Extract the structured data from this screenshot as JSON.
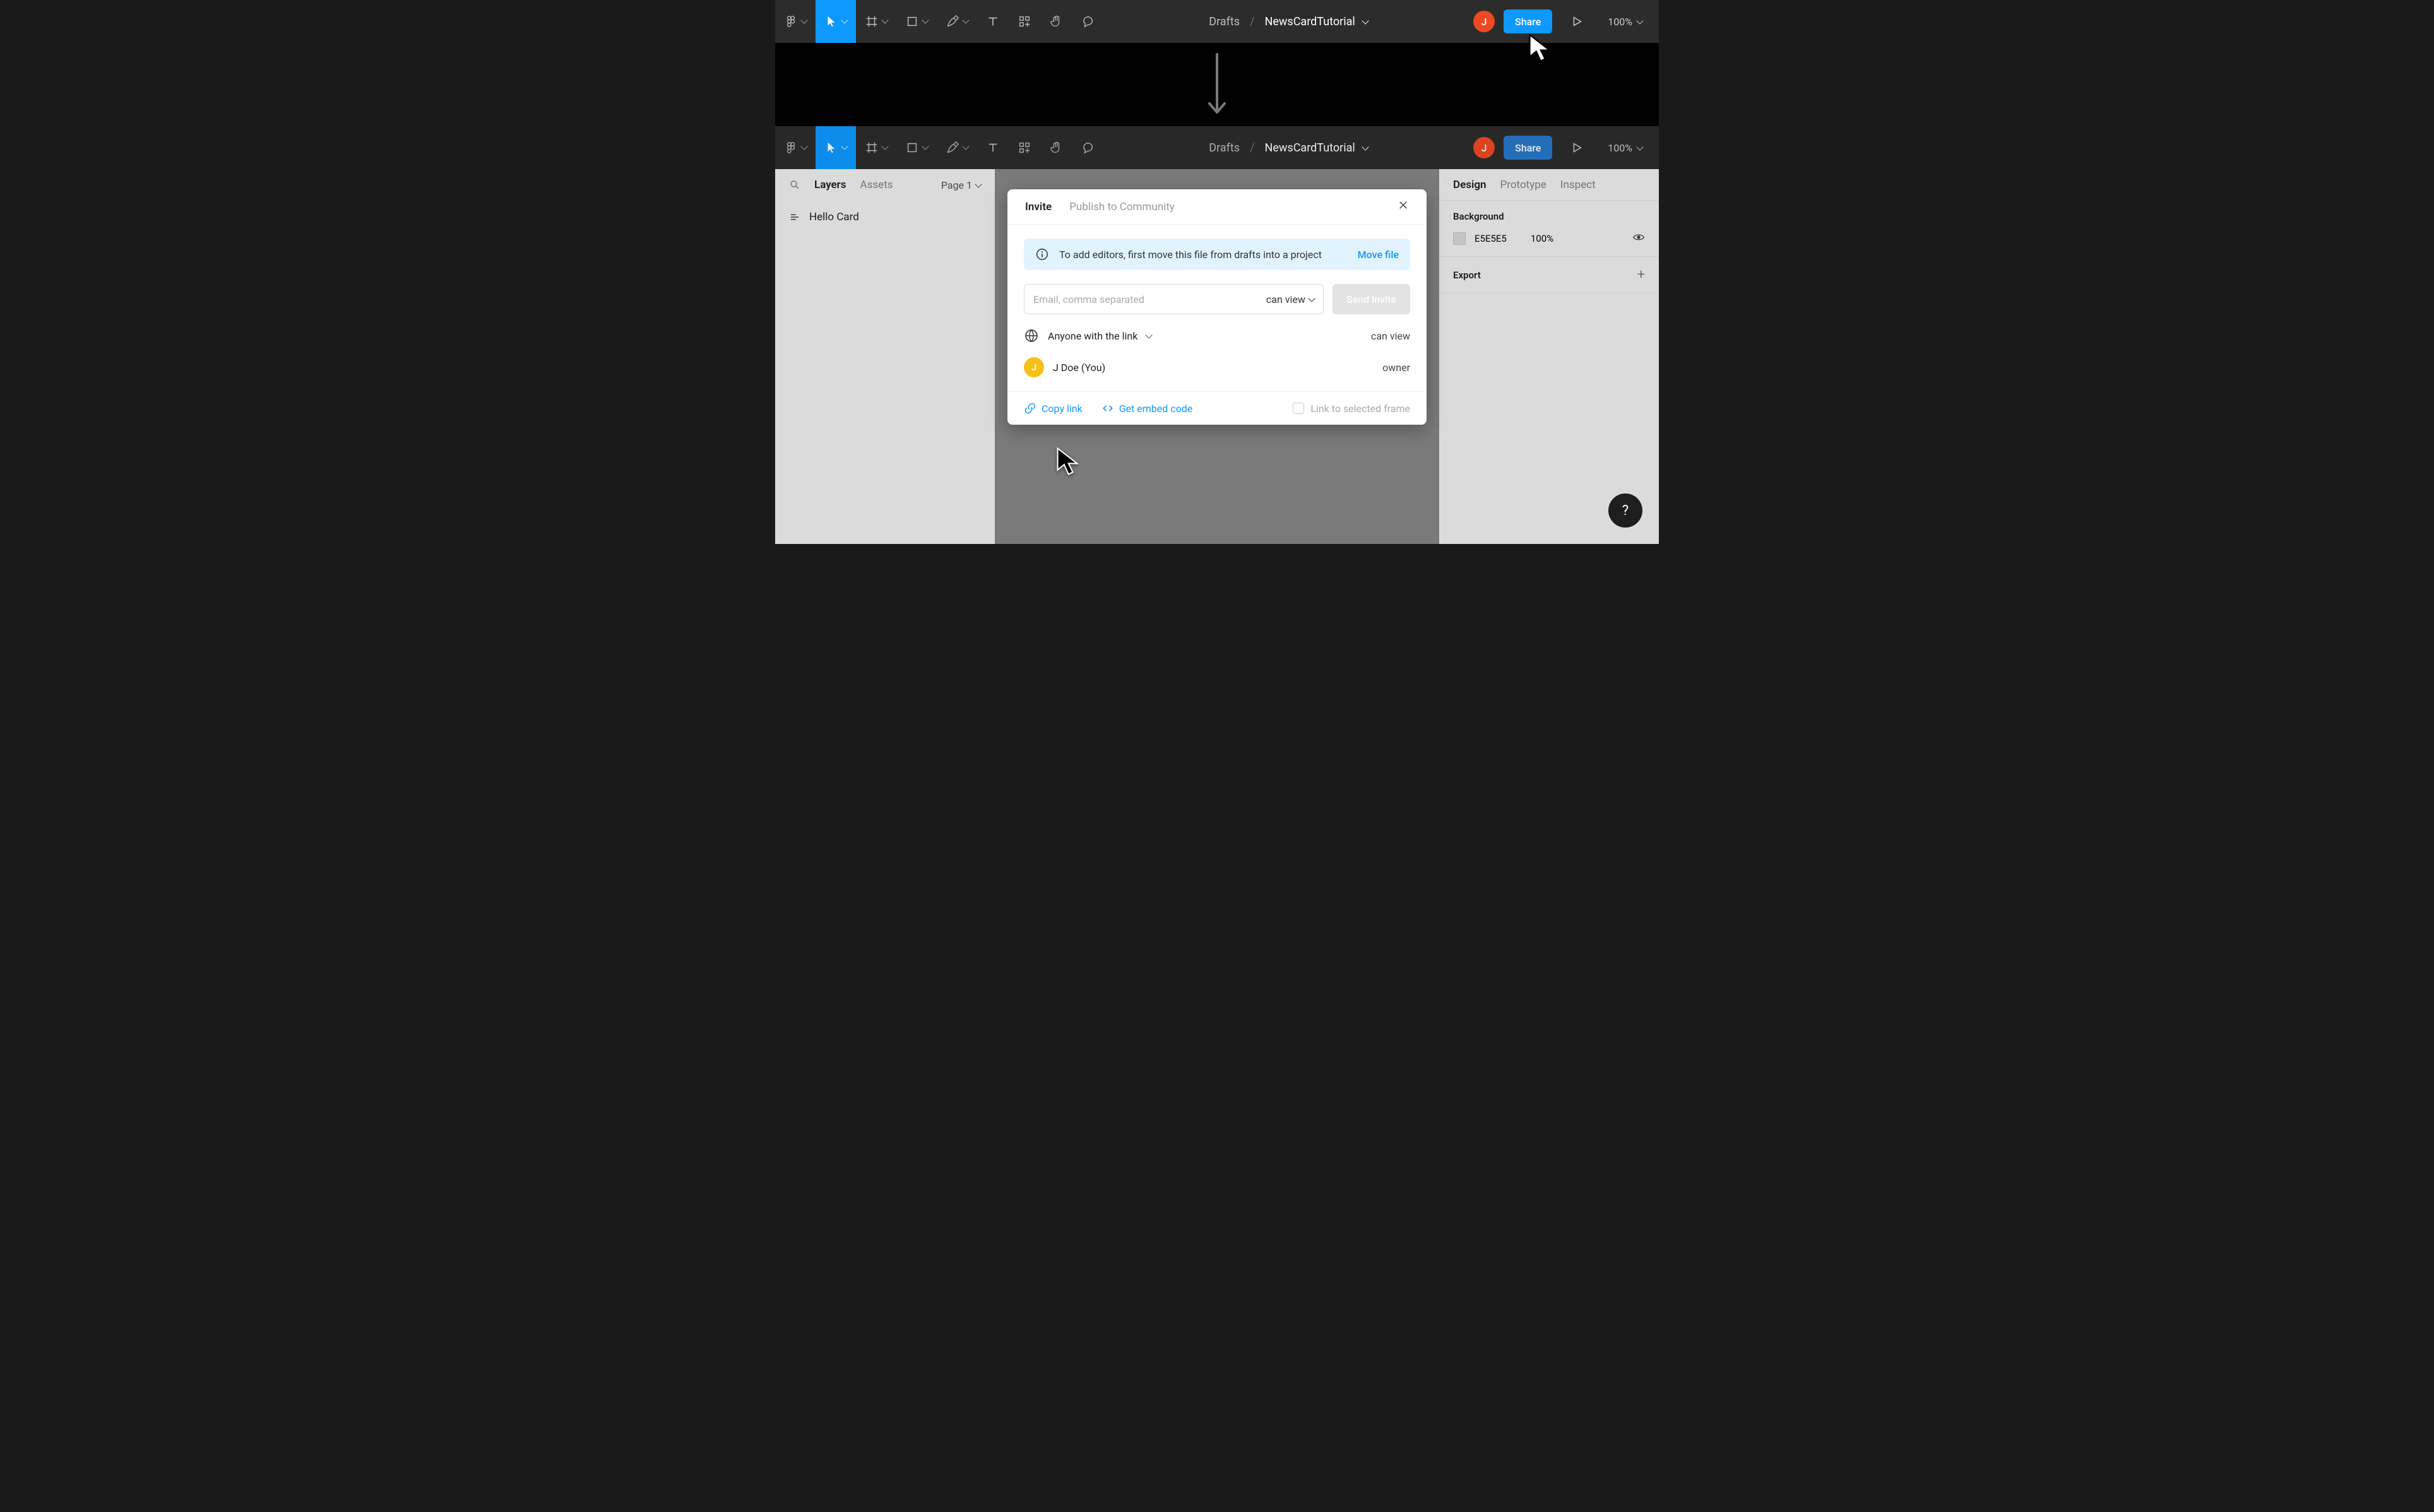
{
  "breadcrumb": {
    "drafts": "Drafts",
    "file": "NewsCardTutorial"
  },
  "share_label": "Share",
  "zoom": "100%",
  "avatar_initial": "J",
  "left_panel": {
    "tabs": {
      "layers": "Layers",
      "assets": "Assets"
    },
    "page": "Page 1",
    "layers": [
      {
        "name": "Hello Card"
      }
    ]
  },
  "right_panel": {
    "tabs": {
      "design": "Design",
      "prototype": "Prototype",
      "inspect": "Inspect"
    },
    "background": {
      "title": "Background",
      "hex": "E5E5E5",
      "opacity": "100%"
    },
    "export_title": "Export"
  },
  "modal": {
    "tabs": {
      "invite": "Invite",
      "publish": "Publish to Community"
    },
    "info": {
      "text": "To add editors, first move this file from drafts into a project",
      "action": "Move file"
    },
    "invite": {
      "placeholder": "Email, comma separated",
      "perm": "can view",
      "send": "Send invite"
    },
    "link_access": {
      "label": "Anyone with the link",
      "perm": "can view"
    },
    "owner": {
      "name": "J Doe (You)",
      "role": "owner",
      "initial": "J"
    },
    "footer": {
      "copy": "Copy link",
      "embed": "Get embed code",
      "frame_cb": "Link to selected frame"
    }
  }
}
